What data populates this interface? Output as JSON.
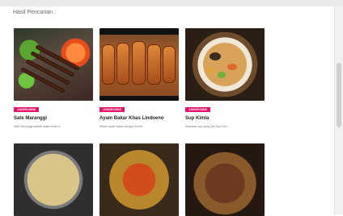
{
  "section": {
    "title": "Hasil Pencarian :"
  },
  "colors": {
    "badge": "#e5126b"
  },
  "cards": [
    {
      "badge": "JANGKAWA",
      "name": "Sate Maranggi",
      "desc": "Sate Maranggi adalah sajian khas d..."
    },
    {
      "badge": "JANGKAWA",
      "name": "Ayam Bakar Khas Lindoeno",
      "desc": "Selain ayam bakar dengan bumb..."
    },
    {
      "badge": "JANGKAWA",
      "name": "Sup Kimla",
      "desc": "Masakan sup yang jadi Sop Nex..."
    }
  ]
}
